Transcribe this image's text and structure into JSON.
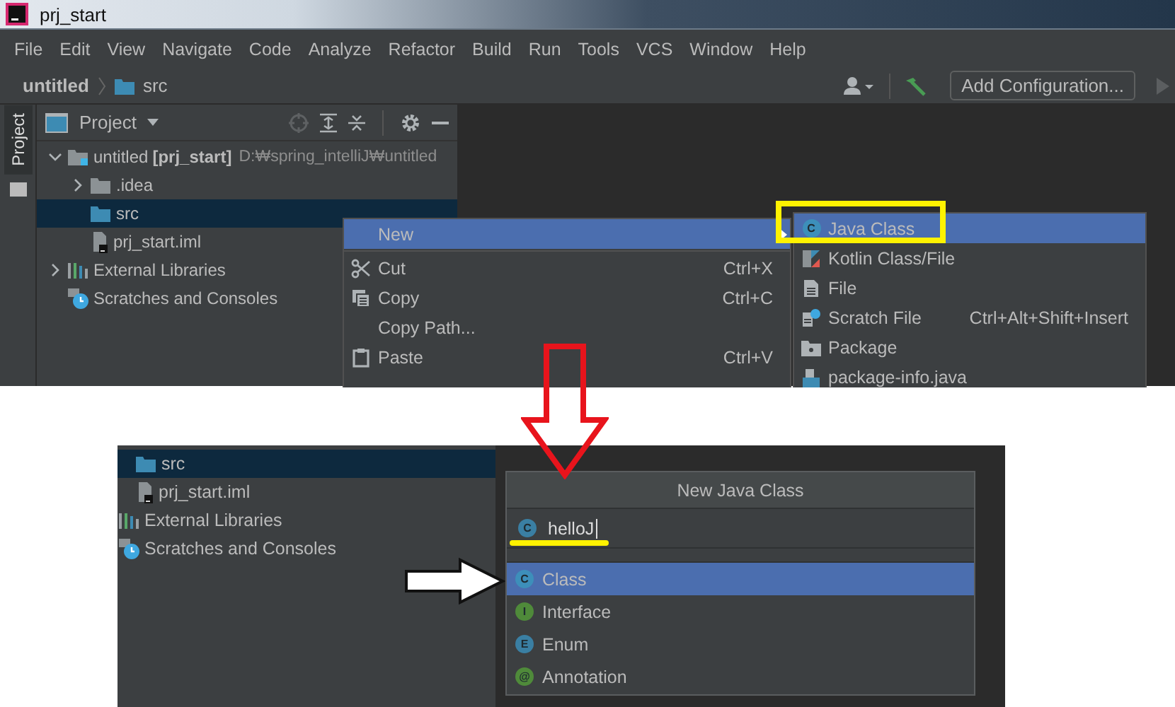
{
  "top_window": {
    "title": "prj_start",
    "menu": [
      "File",
      "Edit",
      "View",
      "Navigate",
      "Code",
      "Analyze",
      "Refactor",
      "Build",
      "Run",
      "Tools",
      "VCS",
      "Window",
      "Help"
    ],
    "breadcrumb": [
      "untitled",
      "src"
    ],
    "run_config": "Add Configuration...",
    "tool_tab": "Project",
    "panel_title": "Project",
    "tree": [
      {
        "label": "untitled",
        "suffix": "[prj_start]",
        "path": "D:₩spring_intelliJ₩untitled",
        "kind": "module",
        "expanded": true,
        "selected": false,
        "children": [
          {
            "label": ".idea",
            "kind": "folder",
            "expanded": false,
            "selected": false
          },
          {
            "label": "src",
            "kind": "source_folder",
            "selected": true
          },
          {
            "label": "prj_start.iml",
            "kind": "iml",
            "selected": false
          }
        ]
      },
      {
        "label": "External Libraries",
        "kind": "libraries",
        "expanded": false,
        "selected": false
      },
      {
        "label": "Scratches and Consoles",
        "kind": "scratches",
        "selected": false
      }
    ],
    "context_menu": [
      {
        "label": "New",
        "kind": "new",
        "selected": true,
        "submenu": true
      },
      {
        "label": "Cut",
        "kind": "cut",
        "shortcut": "Ctrl+X",
        "selected": false
      },
      {
        "label": "Copy",
        "kind": "copy",
        "shortcut": "Ctrl+C",
        "selected": false
      },
      {
        "label": "Copy Path...",
        "kind": "none",
        "selected": false
      },
      {
        "label": "Paste",
        "kind": "paste",
        "shortcut": "Ctrl+V",
        "selected": false
      }
    ],
    "new_submenu": [
      {
        "label": "Java Class",
        "kind": "class",
        "badge": "C",
        "selected": true
      },
      {
        "label": "Kotlin Class/File",
        "kind": "kotlin",
        "selected": false
      },
      {
        "label": "File",
        "kind": "file",
        "selected": false
      },
      {
        "label": "Scratch File",
        "kind": "scratch",
        "shortcut": "Ctrl+Alt+Shift+Insert",
        "selected": false
      },
      {
        "label": "Package",
        "kind": "package",
        "selected": false
      },
      {
        "label": "package-info.java",
        "kind": "package_info",
        "selected": false
      }
    ]
  },
  "bottom_window": {
    "tree": [
      {
        "label": "src",
        "kind": "source_folder",
        "selected": true
      },
      {
        "label": "prj_start.iml",
        "kind": "iml",
        "selected": false
      },
      {
        "label": "External Libraries",
        "kind": "libraries",
        "selected": false
      },
      {
        "label": "Scratches and Consoles",
        "kind": "scratches",
        "selected": false
      }
    ],
    "dialog": {
      "title": "New Java Class",
      "badge": "C",
      "value": "helloJ",
      "options": [
        {
          "label": "Class",
          "badge": "C",
          "color": "#3d8fba",
          "selected": true
        },
        {
          "label": "Interface",
          "badge": "I",
          "color": "#4f8a3a",
          "selected": false
        },
        {
          "label": "Enum",
          "badge": "E",
          "color": "#3a7fa3",
          "selected": false
        },
        {
          "label": "Annotation",
          "badge": "@",
          "color": "#4f8a3a",
          "selected": false
        }
      ]
    }
  }
}
